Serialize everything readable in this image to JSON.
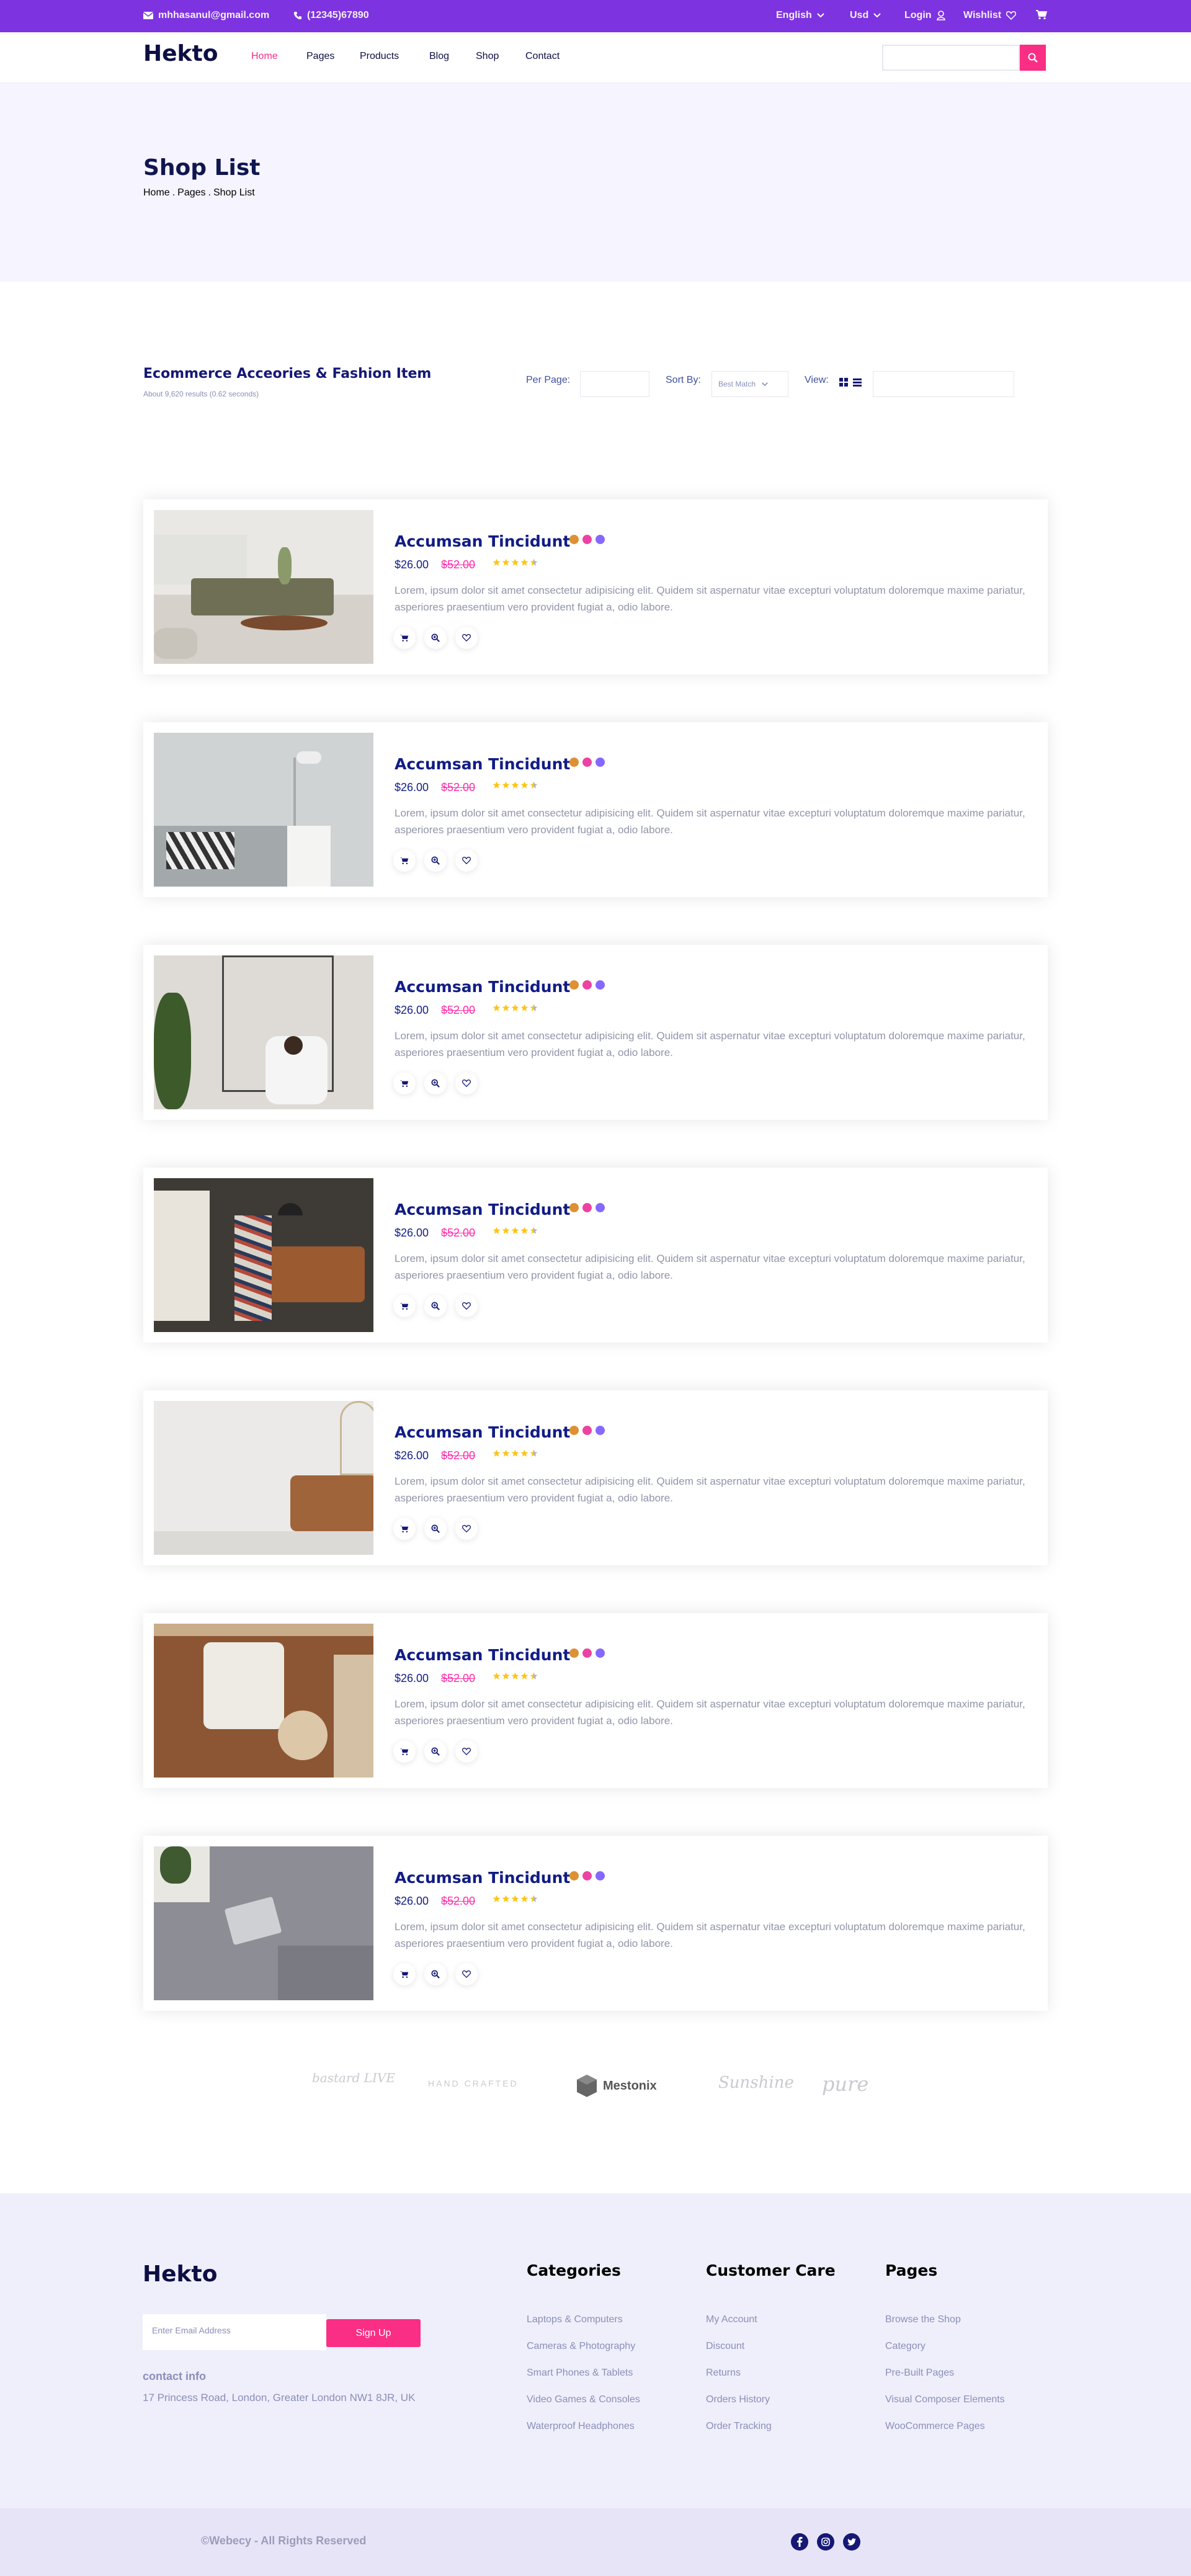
{
  "topbar": {
    "email": "mhhasanul@gmail.com",
    "phone": "(12345)67890",
    "language": "English",
    "currency": "Usd",
    "login": "Login",
    "wishlist": "Wishlist"
  },
  "header": {
    "logo": "Hekto",
    "nav": [
      "Home",
      "Pages",
      "Products",
      "Blog",
      "Shop",
      "Contact"
    ],
    "search_value": ""
  },
  "hero": {
    "title": "Shop List",
    "breadcrumb": [
      "Home",
      "Pages",
      "Shop List"
    ]
  },
  "toolbar": {
    "title": "Ecommerce Acceories & Fashion Item",
    "results": "About 9,620 results (0.62 seconds)",
    "per_page_label": "Per Page:",
    "per_page_value": "",
    "sort_label": "Sort By:",
    "sort_value": "Best Match",
    "view_label": "View:",
    "view_input_value": ""
  },
  "products": [
    {
      "name": "Accumsan Tincidunt",
      "price": "$26.00",
      "old_price": "$52.00",
      "rating": 4.5,
      "image": "green-sofa-living-room",
      "description": "Lorem, ipsum dolor sit amet consectetur adipisicing elit. Quidem sit aspernatur vitae excepturi voluptatum doloremque maxime pariatur, asperiores praesentium vero provident fugiat a, odio labore."
    },
    {
      "name": "Accumsan Tincidunt",
      "price": "$26.00",
      "old_price": "$52.00",
      "rating": 4.5,
      "image": "grey-sofa-with-lamp",
      "description": "Lorem, ipsum dolor sit amet consectetur adipisicing elit. Quidem sit aspernatur vitae excepturi voluptatum doloremque maxime pariatur, asperiores praesentium vero provident fugiat a, odio labore."
    },
    {
      "name": "Accumsan Tincidunt",
      "price": "$26.00",
      "old_price": "$52.00",
      "rating": 4.5,
      "image": "man-in-white-room",
      "description": "Lorem, ipsum dolor sit amet consectetur adipisicing elit. Quidem sit aspernatur vitae excepturi voluptatum doloremque maxime pariatur, asperiores praesentium vero provident fugiat a, odio labore."
    },
    {
      "name": "Accumsan Tincidunt",
      "price": "$26.00",
      "old_price": "$52.00",
      "rating": 4.5,
      "image": "brown-leather-sofa-dark-room",
      "description": "Lorem, ipsum dolor sit amet consectetur adipisicing elit. Quidem sit aspernatur vitae excepturi voluptatum doloremque maxime pariatur, asperiores praesentium vero provident fugiat a, odio labore."
    },
    {
      "name": "Accumsan Tincidunt",
      "price": "$26.00",
      "old_price": "$52.00",
      "rating": 4.5,
      "image": "leather-sofa-white-wall",
      "description": "Lorem, ipsum dolor sit amet consectetur adipisicing elit. Quidem sit aspernatur vitae excepturi voluptatum doloremque maxime pariatur, asperiores praesentium vero provident fugiat a, odio labore."
    },
    {
      "name": "Accumsan Tincidunt",
      "price": "$26.00",
      "old_price": "$52.00",
      "rating": 4.5,
      "image": "leather-sofa-cushions",
      "description": "Lorem, ipsum dolor sit amet consectetur adipisicing elit. Quidem sit aspernatur vitae excepturi voluptatum doloremque maxime pariatur, asperiores praesentium vero provident fugiat a, odio labore."
    },
    {
      "name": "Accumsan Tincidunt",
      "price": "$26.00",
      "old_price": "$52.00",
      "rating": 4.5,
      "image": "grey-sofa-laptop",
      "description": "Lorem, ipsum dolor sit amet consectetur adipisicing elit. Quidem sit aspernatur vitae excepturi voluptatum doloremque maxime pariatur, asperiores praesentium vero provident fugiat a, odio labore."
    }
  ],
  "color_dots": [
    "#de9034",
    "#ec42a2",
    "#8568ff"
  ],
  "brands": [
    "bastard LIVE",
    "HAND CRAFTED",
    "Mestonix",
    "Sunshine",
    "pure"
  ],
  "footer": {
    "logo": "Hekto",
    "email_placeholder": "Enter Email Address",
    "signup": "Sign Up",
    "contact_label": "contact info",
    "address": "17 Princess Road, London, Greater London NW1 8JR, UK",
    "columns": [
      {
        "title": "Categories",
        "links": [
          "Laptops & Computers",
          "Cameras & Photography",
          "Smart Phones & Tablets",
          "Video Games & Consoles",
          "Waterproof Headphones"
        ]
      },
      {
        "title": "Customer Care",
        "links": [
          "My Account",
          "Discount",
          "Returns",
          "Orders History",
          "Order Tracking"
        ]
      },
      {
        "title": "Pages",
        "links": [
          "Browse the Shop",
          "Category",
          "Pre-Built Pages",
          "Visual Composer Elements",
          "WooCommerce Pages"
        ]
      }
    ],
    "copyright": "©Webecy - All Rights Reserved",
    "social": [
      "facebook-icon",
      "instagram-icon",
      "twitter-icon"
    ]
  },
  "colors": {
    "primary": "#7e33e0",
    "accent": "#fb2e86",
    "navy": "#151875",
    "hero_bg": "#f6f5ff",
    "footer_bg": "#eeeffb",
    "star": "#ffc416"
  }
}
